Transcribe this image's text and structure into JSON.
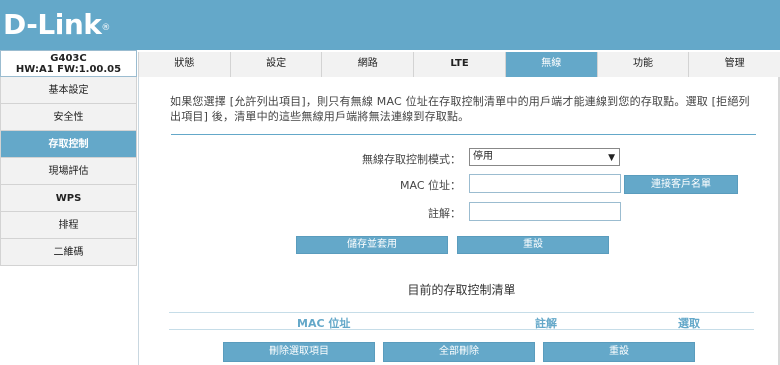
{
  "brand": {
    "logo": "D-Link",
    "reg": "®"
  },
  "device": {
    "model": "G403C",
    "version": "HW:A1   FW:1.00.05"
  },
  "sidebar": {
    "items": [
      {
        "label": "基本設定"
      },
      {
        "label": "安全性"
      },
      {
        "label": "存取控制"
      },
      {
        "label": "現場評估"
      },
      {
        "label": "WPS"
      },
      {
        "label": "排程"
      },
      {
        "label": "二維碼"
      }
    ]
  },
  "tabs": [
    {
      "label": "狀態"
    },
    {
      "label": "設定"
    },
    {
      "label": "網路"
    },
    {
      "label": "LTE"
    },
    {
      "label": "無線"
    },
    {
      "label": "功能"
    },
    {
      "label": "管理"
    }
  ],
  "main": {
    "description": "如果您選擇 [允許列出項目]，則只有無線 MAC 位址在存取控制清單中的用戶端才能連線到您的存取點。選取 [拒絕列出項目] 後，清單中的這些無線用戶端將無法連線到存取點。",
    "mode_label": "無線存取控制模式：",
    "mode_value": "停用",
    "mac_label": "MAC 位址：",
    "mac_value": "",
    "client_list_button": "連接客戶名單",
    "note_label": "註解：",
    "note_value": "",
    "save_apply_button": "儲存並套用",
    "reset_button": "重設",
    "list_title": "目前的存取控制清單",
    "columns": [
      "MAC 位址",
      "註解",
      "選取"
    ],
    "delete_selected_button": "刪除選取項目",
    "delete_all_button": "全部刪除",
    "reset2_button": "重設"
  },
  "colors": {
    "accent": "#64a8c9"
  }
}
